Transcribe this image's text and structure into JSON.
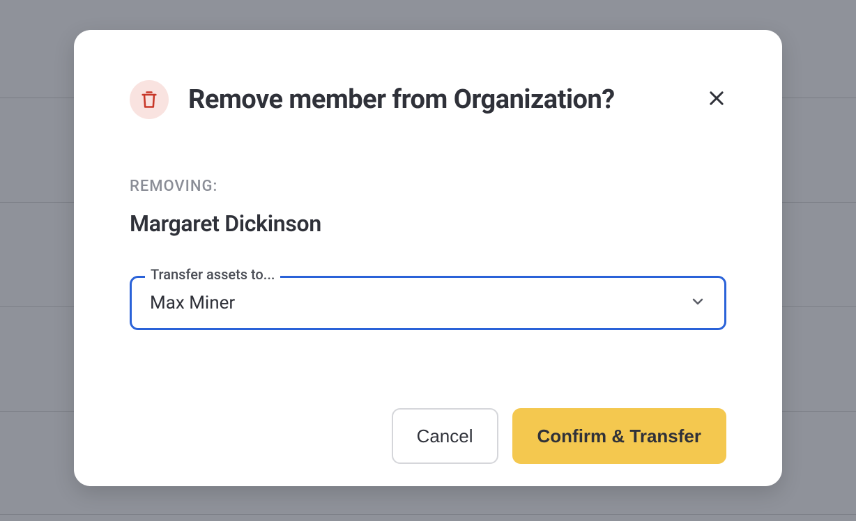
{
  "modal": {
    "title": "Remove member from Organization?",
    "removing_label": "REMOVING:",
    "removing_name": "Margaret Dickinson",
    "transfer": {
      "legend": "Transfer assets to...",
      "selected": "Max Miner"
    },
    "actions": {
      "cancel": "Cancel",
      "confirm": "Confirm & Transfer"
    }
  },
  "colors": {
    "accent_primary": "#f4c84f",
    "focus_border": "#2a62d8",
    "danger_icon": "#c83728"
  }
}
